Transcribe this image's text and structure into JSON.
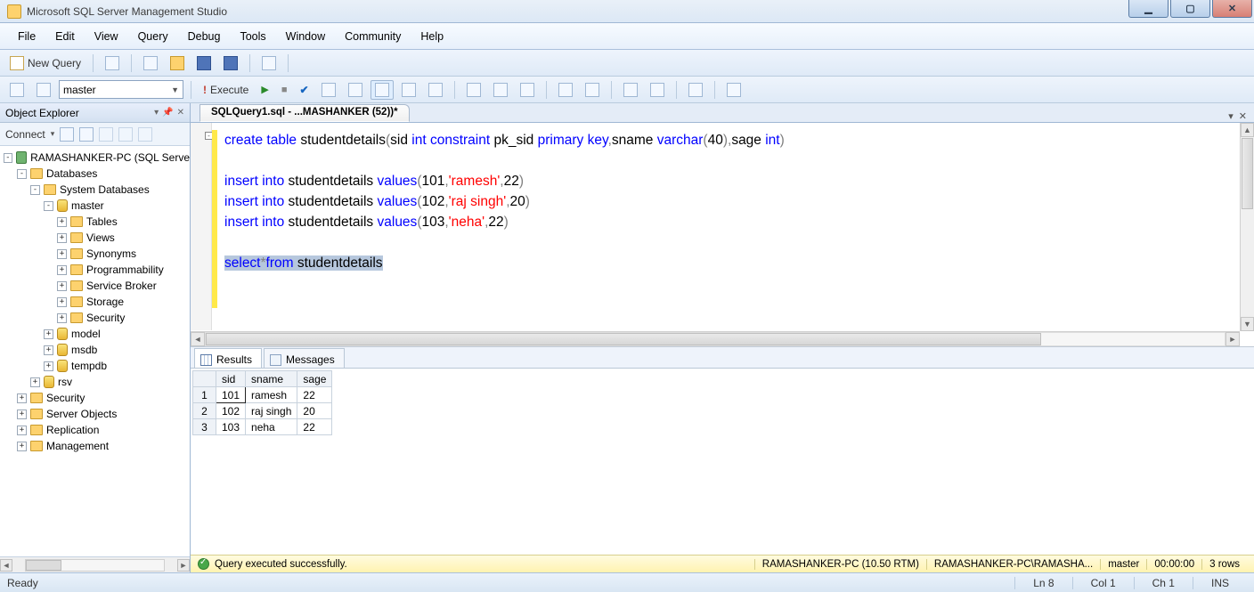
{
  "title": "Microsoft SQL Server Management Studio",
  "menu": [
    "File",
    "Edit",
    "View",
    "Query",
    "Debug",
    "Tools",
    "Window",
    "Community",
    "Help"
  ],
  "toolbar1": {
    "newQuery": "New Query"
  },
  "toolbar2": {
    "dbName": "master",
    "execute": "Execute"
  },
  "objectExplorer": {
    "title": "Object Explorer",
    "connect": "Connect",
    "root": "RAMASHANKER-PC (SQL Serve",
    "nodes": {
      "databases": "Databases",
      "sysdb": "System Databases",
      "master": "master",
      "masterChildren": [
        "Tables",
        "Views",
        "Synonyms",
        "Programmability",
        "Service Broker",
        "Storage",
        "Security"
      ],
      "model": "model",
      "msdb": "msdb",
      "tempdb": "tempdb",
      "rsv": "rsv",
      "top": [
        "Security",
        "Server Objects",
        "Replication",
        "Management"
      ]
    }
  },
  "queryTab": "SQLQuery1.sql - ...MASHANKER (52))*",
  "sql": {
    "l1a": "create ",
    "l1b": "table ",
    "l1c": "studentdetails",
    "l1d": "(",
    "l1e": "sid ",
    "l1f": "int ",
    "l1g": "constraint ",
    "l1h": "pk_sid ",
    "l1i": "primary ",
    "l1j": "key",
    "l1k": ",",
    "l1l": "sname ",
    "l1m": "varchar",
    "l1n": "(",
    "l1o": "40",
    "l1p": ")",
    "l1q": ",",
    "l1r": "sage ",
    "l1s": "int",
    "l1t": ")",
    "ins": "insert ",
    "into": "into ",
    "tbl": "studentdetails ",
    "vals": "values",
    "r1": "(",
    "r1a": "101",
    "r1b": ",",
    "r1c": "'ramesh'",
    "r1d": ",",
    "r1e": "22",
    "r1f": ")",
    "r2a": "102",
    "r2c": "'raj singh'",
    "r2e": "20",
    "r3a": "103",
    "r3c": "'neha'",
    "r3e": "22",
    "sel": "select",
    "star": "*",
    "from": "from ",
    "tbl2": "studentdetails"
  },
  "resultsTabs": {
    "results": "Results",
    "messages": "Messages"
  },
  "grid": {
    "headers": [
      "sid",
      "sname",
      "sage"
    ],
    "rows": [
      {
        "n": "1",
        "sid": "101",
        "sname": "ramesh",
        "sage": "22"
      },
      {
        "n": "2",
        "sid": "102",
        "sname": "raj singh",
        "sage": "20"
      },
      {
        "n": "3",
        "sid": "103",
        "sname": "neha",
        "sage": "22"
      }
    ]
  },
  "queryStatus": {
    "msg": "Query executed successfully.",
    "server": "RAMASHANKER-PC (10.50 RTM)",
    "user": "RAMASHANKER-PC\\RAMASHA...",
    "db": "master",
    "time": "00:00:00",
    "rows": "3 rows"
  },
  "statusbar": {
    "ready": "Ready",
    "ln": "Ln 8",
    "col": "Col 1",
    "ch": "Ch 1",
    "ins": "INS"
  }
}
